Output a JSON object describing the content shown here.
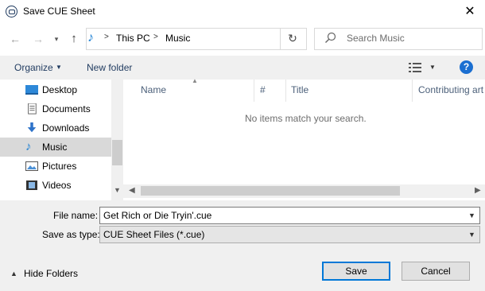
{
  "window": {
    "title": "Save CUE Sheet",
    "close_glyph": "✕"
  },
  "nav": {
    "back_glyph": "←",
    "forward_glyph": "→",
    "recent_glyph": "▾",
    "up_glyph": "↑",
    "breadcrumb": [
      "This PC",
      "Music"
    ],
    "breadcrumb_sep": ">",
    "refresh_glyph": "↻"
  },
  "search": {
    "placeholder": "Search Music"
  },
  "toolbar": {
    "organize_label": "Organize",
    "new_folder_label": "New folder",
    "help_glyph": "?"
  },
  "sidebar": {
    "items": [
      {
        "label": "Desktop",
        "icon": "desktop-icon"
      },
      {
        "label": "Documents",
        "icon": "documents-icon"
      },
      {
        "label": "Downloads",
        "icon": "downloads-icon"
      },
      {
        "label": "Music",
        "icon": "music-icon",
        "selected": true
      },
      {
        "label": "Pictures",
        "icon": "pictures-icon"
      },
      {
        "label": "Videos",
        "icon": "videos-icon"
      }
    ]
  },
  "content": {
    "columns": [
      "Name",
      "#",
      "Title",
      "Contributing art"
    ],
    "empty_message": "No items match your search."
  },
  "form": {
    "file_name_label": "File name:",
    "file_name_value": "Get Rich or Die Tryin'.cue",
    "save_type_label": "Save as type:",
    "save_type_value": "CUE Sheet Files (*.cue)"
  },
  "footer": {
    "hide_folders_label": "Hide Folders",
    "save_label": "Save",
    "cancel_label": "Cancel"
  },
  "colors": {
    "accent": "#0078d7",
    "selected": "#d9d9d9",
    "link": "#1f3a5f"
  }
}
